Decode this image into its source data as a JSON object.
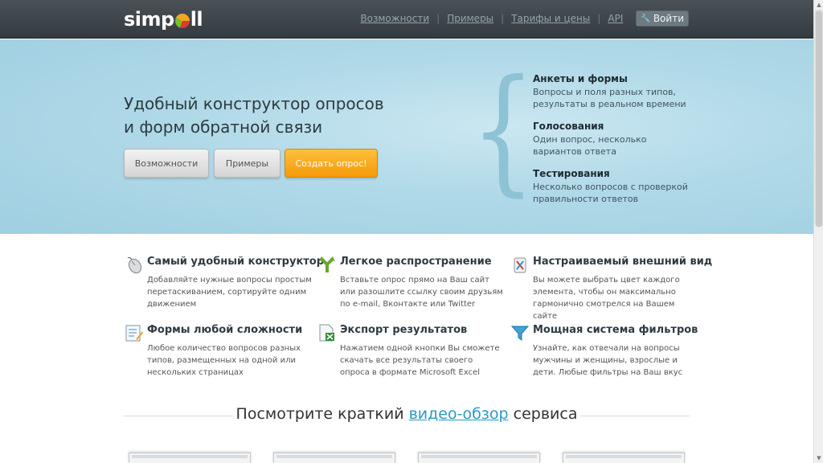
{
  "header": {
    "logo_text_pre": "simp",
    "logo_text_post": "ll",
    "nav": [
      "Возможности",
      "Примеры",
      "Тарифы и цены",
      "API"
    ],
    "login_label": "Войти",
    "login_icon": "key-icon"
  },
  "hero": {
    "title_line1": "Удобный конструктор опросов",
    "title_line2": "и форм обратной связи",
    "buttons": {
      "features": "Возможности",
      "examples": "Примеры",
      "create": "Создать опрос!"
    },
    "features": [
      {
        "title": "Анкеты и формы",
        "text_line1": "Вопросы и поля разных типов,",
        "text_line2": "результаты в реальном времени"
      },
      {
        "title": "Голосования",
        "text_line1": "Один вопрос, несколько",
        "text_line2": "вариантов ответа"
      },
      {
        "title": "Тестирования",
        "text_line1": "Несколько вопросов с проверкой",
        "text_line2": "правильности ответов"
      }
    ]
  },
  "features": [
    {
      "icon": "mouse-icon",
      "title": "Самый удобный конструктор",
      "text": "Добавляйте нужные вопросы простым перетаскиванием, сортируйте одним движением"
    },
    {
      "icon": "share-arrows-icon",
      "title": "Легкое распространение",
      "text": "Вставьте опрос прямо на Ваш сайт или разошлите ссылку своим друзьям по e-mail, Вконтакте или Twitter"
    },
    {
      "icon": "paint-icon",
      "title": "Настраиваемый внешний вид",
      "text": "Вы можете выбрать цвет каждого элемента, чтобы он максимально гармонично смотрелся на Вашем сайте"
    },
    {
      "icon": "form-edit-icon",
      "title": "Формы любой сложности",
      "text": "Любое количество вопросов разных типов, размещенных на одной или нескольких страницах"
    },
    {
      "icon": "excel-export-icon",
      "title": "Экспорт результатов",
      "text": "Нажатием одной кнопки Вы сможете скачать все результаты своего опроса в формате Microsoft Excel"
    },
    {
      "icon": "funnel-icon",
      "title": "Мощная система фильтров",
      "text": "Узнайте, как отвечали на вопросы мужчины и женщины, взрослые и дети. Любые фильтры на Ваш вкус"
    }
  ],
  "video": {
    "prefix": "Посмотрите краткий",
    "link": "видео-обзор",
    "suffix": "сервиса"
  },
  "colors": {
    "accent_orange": "#f7a520",
    "link_blue": "#2a9bc2",
    "hero_bg": "#b0d9e8"
  }
}
